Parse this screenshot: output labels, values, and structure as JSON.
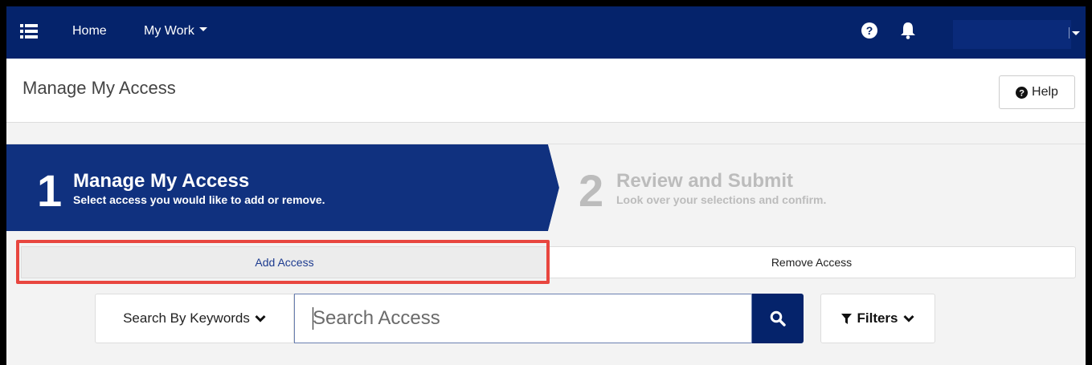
{
  "nav": {
    "menu_icon": "list-menu-icon",
    "home_label": "Home",
    "my_work_label": "My Work",
    "help_icon": "question-circle-icon",
    "notifications_icon": "bell-icon",
    "user_menu_caret": "caret-down-icon"
  },
  "header": {
    "page_title": "Manage My Access",
    "help_button_label": "Help",
    "help_button_icon": "question-circle-icon"
  },
  "steps": [
    {
      "number": "1",
      "title": "Manage My Access",
      "subtitle": "Select access you would like to add or remove.",
      "active": true
    },
    {
      "number": "2",
      "title": "Review and Submit",
      "subtitle": "Look over your selections and confirm.",
      "active": false
    }
  ],
  "tabs": {
    "add_label": "Add Access",
    "remove_label": "Remove Access",
    "selected": "Add Access"
  },
  "search": {
    "mode_label": "Search By Keywords",
    "placeholder": "Search Access",
    "value": "",
    "search_icon": "magnifier-icon"
  },
  "filters": {
    "label": "Filters",
    "icon": "funnel-icon"
  },
  "colors": {
    "brand_navy": "#05236b",
    "step_active": "#10317f",
    "highlight_red": "#e8463f"
  }
}
